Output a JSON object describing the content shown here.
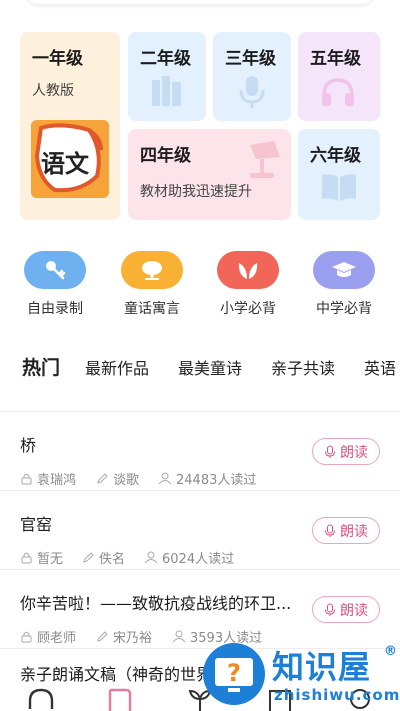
{
  "grades": {
    "g1": {
      "title": "一年级",
      "subtitle": "人教版",
      "logo_text": "语文",
      "icon": "yuwen-book-icon"
    },
    "g2": {
      "title": "二年级",
      "icon": "books-icon"
    },
    "g3": {
      "title": "三年级",
      "icon": "microphone-icon"
    },
    "g5": {
      "title": "五年级",
      "icon": "headphones-icon"
    },
    "g4": {
      "title": "四年级",
      "subtitle": "教材助我迅速提升",
      "icon": "desk-lamp-icon"
    },
    "g6": {
      "title": "六年级",
      "icon": "open-book-icon"
    }
  },
  "categories": [
    {
      "label": "自由录制",
      "icon": "key-icon",
      "color": "#6fb1f0"
    },
    {
      "label": "童话寓言",
      "icon": "tree-icon",
      "color": "#f8b133"
    },
    {
      "label": "小学必背",
      "icon": "leaf-icon",
      "color": "#f2665a"
    },
    {
      "label": "中学必背",
      "icon": "graduation-cap-icon",
      "color": "#9a9ff0"
    }
  ],
  "tabs": [
    {
      "label": "热门",
      "active": true
    },
    {
      "label": "最新作品"
    },
    {
      "label": "最美童诗"
    },
    {
      "label": "亲子共读"
    },
    {
      "label": "英语"
    }
  ],
  "items": [
    {
      "title": "桥",
      "author": "袁瑞鸿",
      "writer": "谈歌",
      "reads": "24483人读过",
      "button": "朗读"
    },
    {
      "title": "官窑",
      "author": "暂无",
      "writer": "佚名",
      "reads": "6024人读过",
      "button": "朗读"
    },
    {
      "title": "你辛苦啦！——致敬抗疫战线的环卫...",
      "author": "顾老师",
      "writer": "宋乃裕",
      "reads": "3593人读过",
      "button": "朗读"
    },
    {
      "title": "亲子朗诵文稿（神奇的世界"
    }
  ],
  "watermark": {
    "text": "知识屋",
    "url": "zhishiwu.com",
    "registered": "®"
  },
  "colors": {
    "accent_pink": "#d9537f",
    "watermark_blue": "#1d7fd6"
  }
}
